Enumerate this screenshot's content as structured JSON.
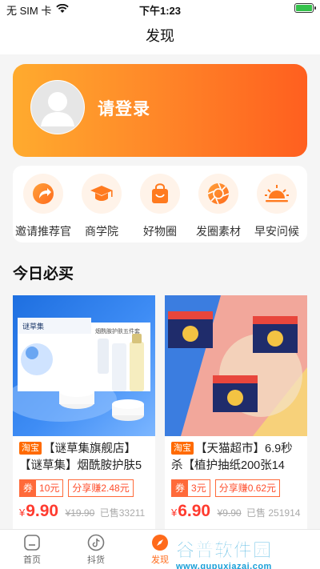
{
  "status_bar": {
    "carrier": "无 SIM 卡",
    "time": "下午1:23",
    "battery_percent": 100
  },
  "nav": {
    "title": "发现"
  },
  "login": {
    "text": "请登录"
  },
  "features": [
    {
      "label": "邀请推荐官",
      "icon": "share-arrow-icon"
    },
    {
      "label": "商学院",
      "icon": "graduation-cap-icon"
    },
    {
      "label": "好物圈",
      "icon": "shopping-bag-icon"
    },
    {
      "label": "发圈素材",
      "icon": "aperture-icon"
    },
    {
      "label": "早安问候",
      "icon": "sunrise-icon"
    }
  ],
  "section": {
    "title": "今日必买"
  },
  "products": [
    {
      "source": "淘宝",
      "title": "【谜草集旗舰店】【谜草集】烟酰胺护肤5",
      "coupon_label": "券",
      "coupon_value": "10元",
      "share": "分享赚2.48元",
      "currency": "¥",
      "price": "9.90",
      "original": "¥19.90",
      "sold": "已售33211",
      "image_brand": "谜草集",
      "image_box": "烟酰胺护肤五件套"
    },
    {
      "source": "淘宝",
      "title": "【天猫超市】6.9秒杀【植护抽纸200张14",
      "coupon_label": "券",
      "coupon_value": "3元",
      "share": "分享赚0.62元",
      "currency": "¥",
      "price": "6.90",
      "original": "¥9.90",
      "sold": "已售 251914"
    }
  ],
  "tabs": [
    {
      "label": "首页",
      "icon": "home-icon",
      "active": false
    },
    {
      "label": "抖货",
      "icon": "tiktok-icon",
      "active": false
    },
    {
      "label": "发现",
      "icon": "compass-icon",
      "active": true
    }
  ],
  "watermark": {
    "text": "谷普软件园",
    "url": "www.gupuxiazai.com"
  },
  "colors": {
    "accent": "#ff6a1a",
    "price": "#ff3b2f",
    "tag": "#ff6a00"
  }
}
